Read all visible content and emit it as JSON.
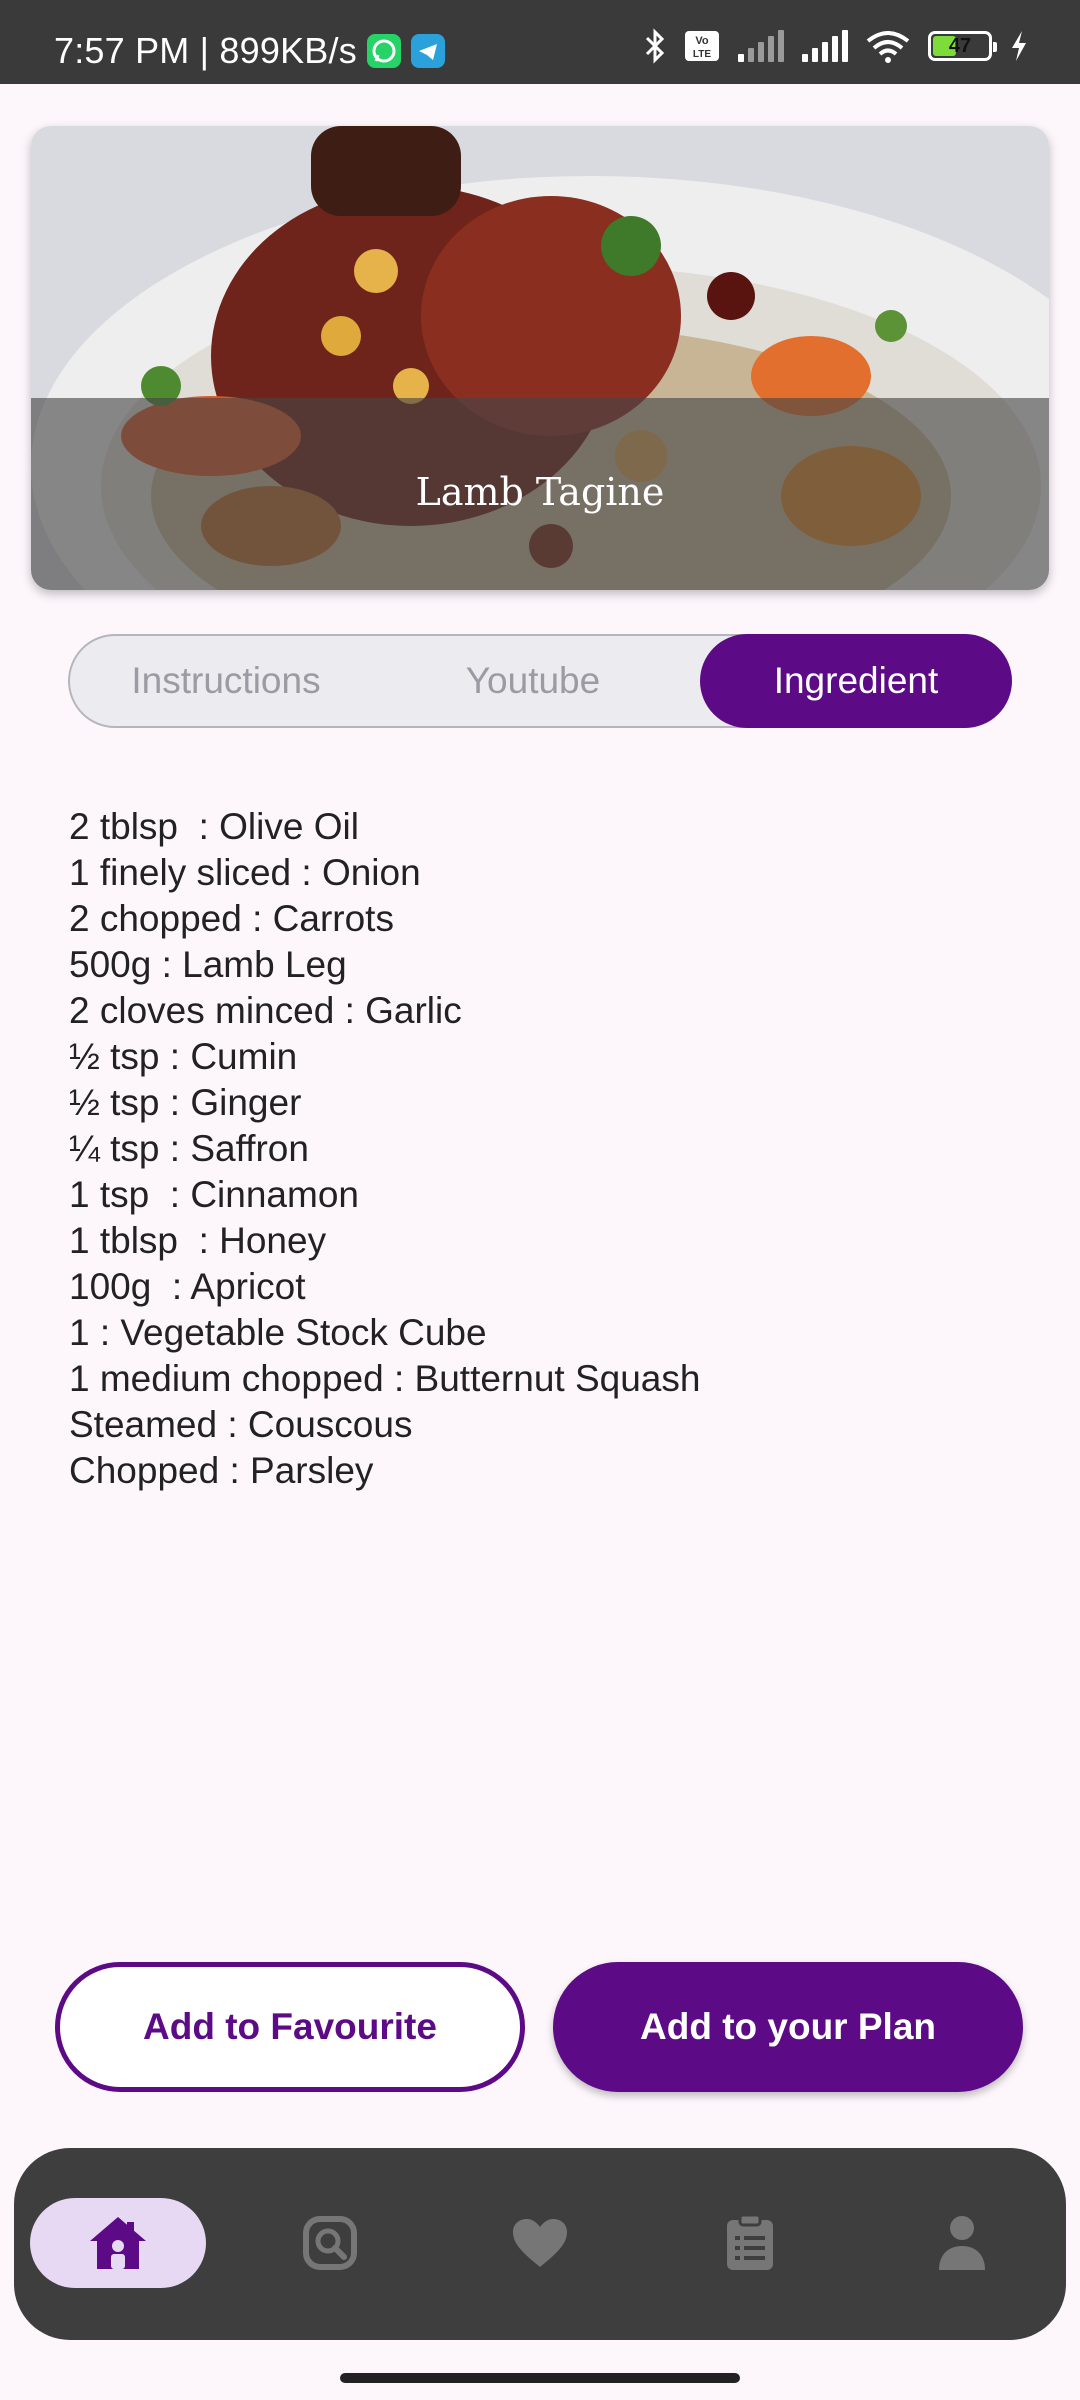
{
  "status_bar": {
    "time_speed": "7:57 PM | 899KB/s",
    "battery": "47",
    "icons": [
      "whatsapp-icon",
      "telegram-icon",
      "bluetooth-icon",
      "volte-icon",
      "signal-icon",
      "wifi-icon",
      "battery-icon",
      "charging-icon"
    ]
  },
  "recipe": {
    "title": "Lamb Tagine",
    "image": "lamb-tagine-photo"
  },
  "tabs": [
    {
      "label": "Instructions",
      "active": false
    },
    {
      "label": "Youtube",
      "active": false
    },
    {
      "label": "Ingredient",
      "active": true
    }
  ],
  "ingredients": [
    "2 tblsp  : Olive Oil",
    "1 finely sliced : Onion",
    "2 chopped : Carrots",
    "500g : Lamb Leg",
    "2 cloves minced : Garlic",
    "½ tsp : Cumin",
    "½ tsp : Ginger",
    "¼ tsp : Saffron",
    "1 tsp  : Cinnamon",
    "1 tblsp  : Honey",
    "100g  : Apricot",
    "1 : Vegetable Stock Cube",
    "1 medium chopped : Butternut Squash",
    "Steamed : Couscous",
    "Chopped : Parsley"
  ],
  "actions": {
    "favourite_label": "Add to Favourite",
    "plan_label": "Add to your Plan"
  },
  "bottom_nav": [
    {
      "icon": "home-icon",
      "active": true
    },
    {
      "icon": "search-icon",
      "active": false
    },
    {
      "icon": "heart-icon",
      "active": false
    },
    {
      "icon": "clipboard-icon",
      "active": false
    },
    {
      "icon": "profile-icon",
      "active": false
    }
  ],
  "colors": {
    "accent": "#5d0a86",
    "background": "#fdf7fc",
    "nav_background": "#3e3e3e",
    "nav_active_pill": "#e7d8f3"
  }
}
